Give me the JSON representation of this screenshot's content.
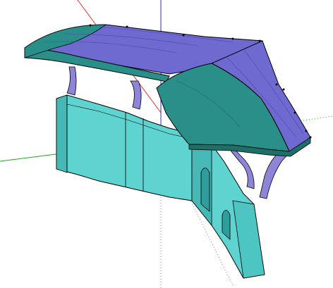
{
  "viewport": {
    "background": "#ffffff",
    "description_visible_text": ""
  },
  "axes": {
    "red_axis_color": "#e0322c",
    "green_axis_color": "#1fa51f",
    "blue_axis_color": "#2b2bd9",
    "dotted_axis_color": "#7b7bcf"
  },
  "model": {
    "wall_color": "#5fd3d0",
    "wall_shade_color": "#46b8b6",
    "wall_dark_color": "#2f9d9c",
    "roof_top_color": "#6e6ad0",
    "roof_face_color": "#2a8f88",
    "roof_face_dark": "#1f6f69",
    "bracket_color": "#8d86d8",
    "edge_color": "#000000"
  }
}
